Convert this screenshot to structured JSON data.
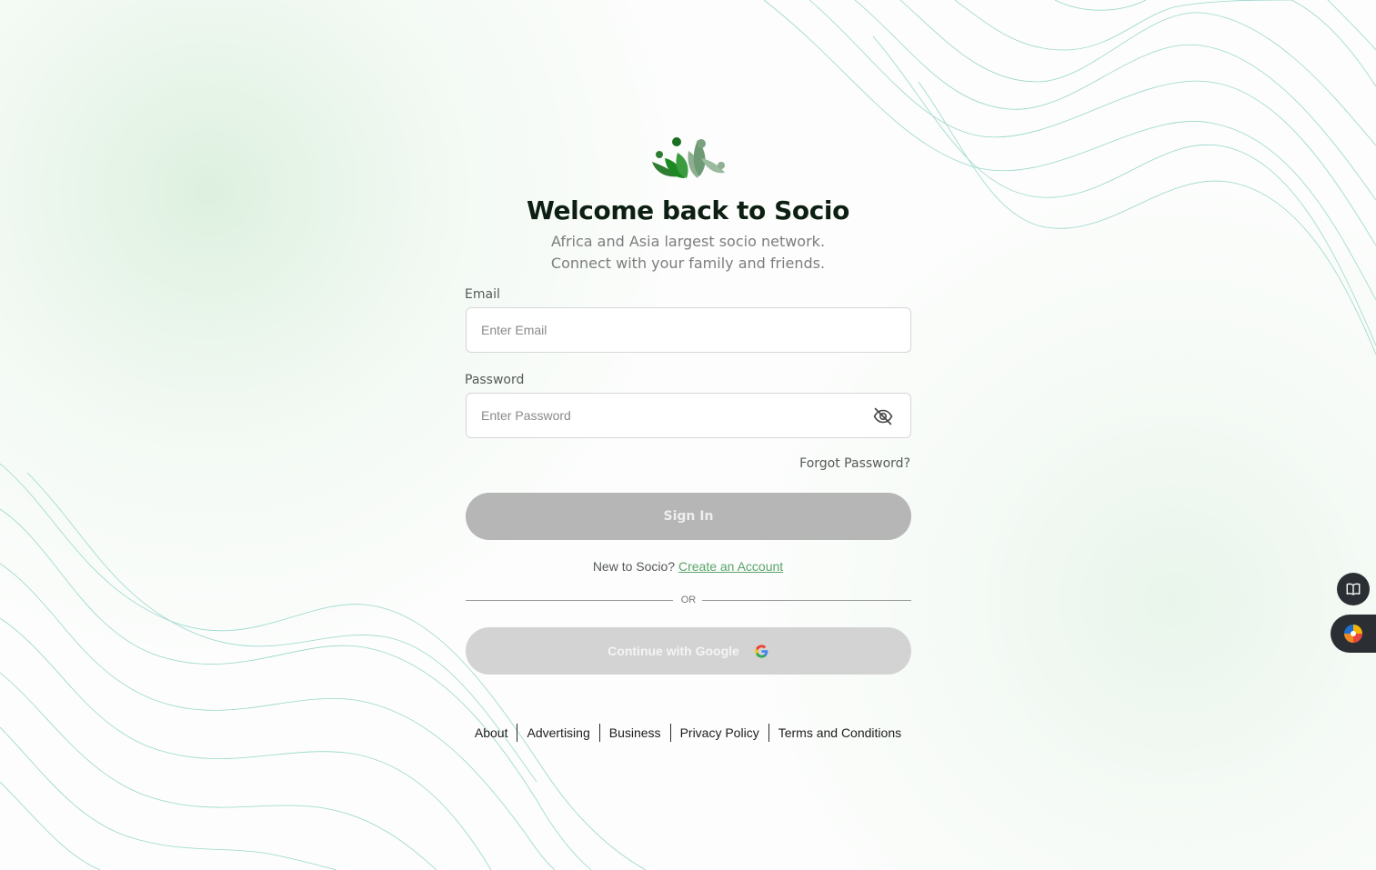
{
  "brand": {
    "logo_icon": "socio-people-leaf-logo",
    "colors": {
      "primary_green": "#1f8a2e",
      "link_green": "#5aa36c",
      "title": "#0d1f12",
      "button_disabled": "#b6b6b6",
      "google_button_disabled": "#d3d3d3",
      "wave_lines": "#8fd3c7"
    }
  },
  "header": {
    "title": "Welcome back to Socio",
    "subtitle_line1": "Africa and Asia largest socio network.",
    "subtitle_line2": "Connect with your family and friends."
  },
  "form": {
    "email": {
      "label": "Email",
      "placeholder": "Enter Email",
      "value": ""
    },
    "password": {
      "label": "Password",
      "placeholder": "Enter Password",
      "value": "",
      "toggle_icon": "eye-off-icon"
    },
    "forgot_label": "Forgot Password?",
    "signin_label": "Sign In",
    "new_prompt": "New to Socio?",
    "create_account_label": "Create an Account",
    "or_label": "OR",
    "google_label": "Continue with Google",
    "google_icon": "google-g-icon"
  },
  "footer": {
    "links": [
      "About",
      "Advertising",
      "Business",
      "Privacy Policy",
      "Terms and Conditions"
    ]
  },
  "side_widgets": {
    "reader_icon": "open-book-icon",
    "extension_icon": "color-wheel-extension-icon"
  }
}
